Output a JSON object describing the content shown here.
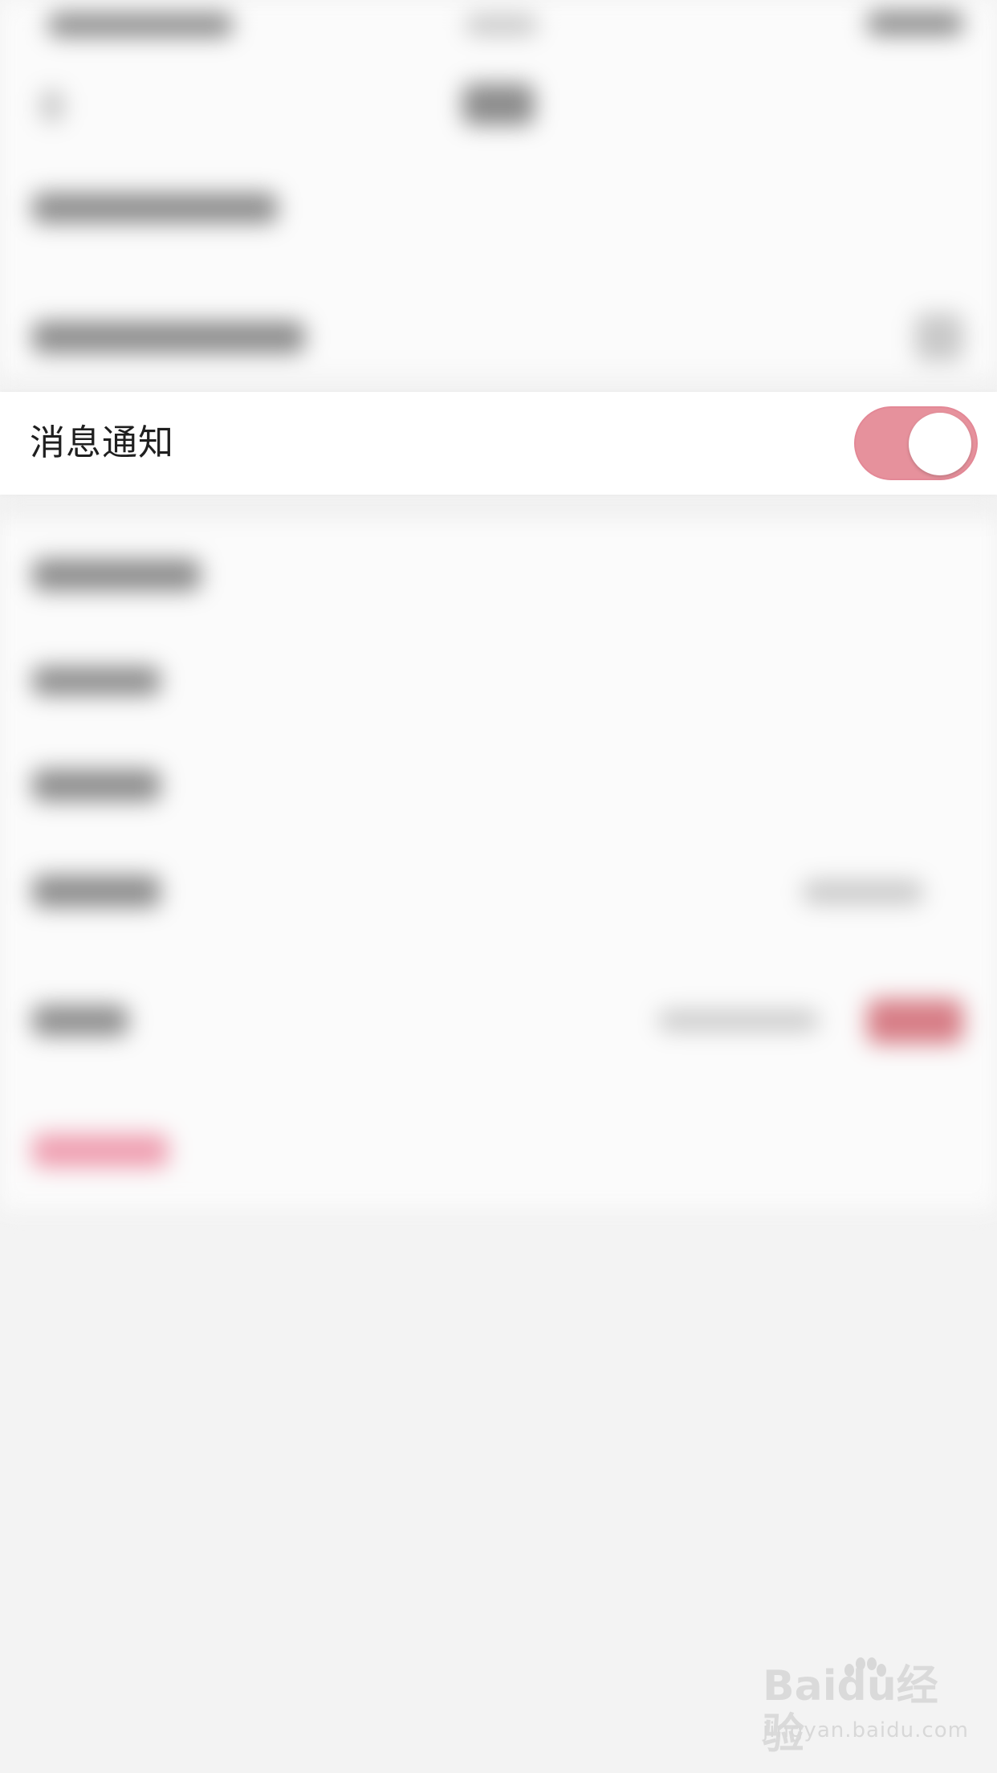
{
  "settings": {
    "notification_row": {
      "label": "消息通知",
      "toggle_on": true
    }
  },
  "watermark": {
    "brand": "Baidu经验",
    "url": "jingyan.baidu.com"
  },
  "colors": {
    "accent_pink": "#e6919c",
    "page_bg": "#f3f3f3",
    "row_bg": "#ffffff"
  }
}
